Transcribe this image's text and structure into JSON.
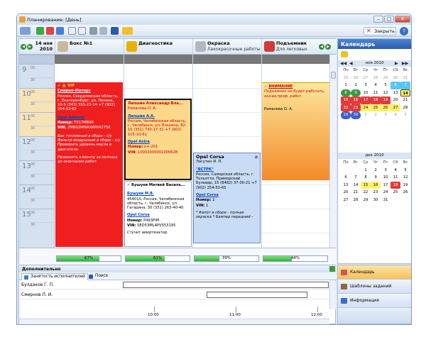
{
  "window": {
    "title": "Планирование: [День]",
    "close_label": "Закрыть",
    "help": "?"
  },
  "schedule": {
    "date_line1": "14 ноя",
    "date_line2": "2010",
    "columns": [
      {
        "name": "Бокс №1",
        "sub": ""
      },
      {
        "name": "Диагностика",
        "sub": ""
      },
      {
        "name": "Окраска",
        "sub": "Лакокрасочные работы"
      },
      {
        "name": "Подъемник",
        "sub": "Для легковых"
      }
    ],
    "hours": [
      "9",
      "10",
      "11",
      "12",
      "13",
      "14",
      "15"
    ],
    "minute_label": "00",
    "half_label": "30",
    "progress": [
      {
        "label": "67%",
        "value": 67
      },
      {
        "label": "61%",
        "value": 61
      },
      {
        "label": "39%",
        "value": 39
      },
      {
        "label": "44%",
        "value": 44
      }
    ]
  },
  "cards": {
    "vip": {
      "badge": "VIP",
      "company": "Смирно-Моторс",
      "addr": "Россия, Свердловская область, г. Екатеринбург, ул. Ленина, 10-5 (343) 355-22-14 +7 (902) 254-53-65",
      "car": "Opel Admiral",
      "num_label": "Номер:",
      "num": "Т917МВ98",
      "vin_label": "VIN:",
      "vin": "2МВGDM9AXKP042756",
      "note1": "Бак топливный в сборе - с/у Фильтр воздушный в сборе - с/у Проверить уровень масла в двигателе.",
      "note2": "Позвонить клиенту за полчаса до окончания работ."
    },
    "lapshin": {
      "title": "Лапшин Александр Вла...",
      "master": "Романова О. А.",
      "name": "Лапшин А.А.",
      "addr": "Россия, Челябинская область, г. Челябинск, ул. Ельхина, 82-10 (351) 740-17-31 +7 (902) 105-10-61",
      "car": "Opel Astra",
      "num_label": "Номер:",
      "num": "к+-201",
      "vin_label": "VIN:",
      "vin": "1000200000100962В"
    },
    "bushuev": {
      "title": "Бушуев Матвей Василь...",
      "name": "Бушуев М.В.",
      "addr": "454010, Россия, Челябинская область, г. Челябинск, ул. Гагарина, 30 (351) 263-40-40",
      "car": "Opel Corsa",
      "num_label": "Номер:",
      "num": "Р493РIМ",
      "vin_label": "VIN:",
      "vin": "SED5ЗМL4PV553195",
      "note": "Стучит амортизатор."
    },
    "corsa": {
      "title": "Opel Corsa",
      "master": "Лагутин И. П.",
      "company": "\"ВСТРК\"",
      "addr": "Россия, Самарская область, г. Тольятти, Приморский Бульвар, 15 (8482) 37-00-21 +7 (902) 254-53-65",
      "car": "Opel Corsa",
      "num_label": "Номер:",
      "num": "2",
      "vin_label": "VIN:",
      "vin": "1",
      "note": "* Капот в сборе - полная окраска * Бампер передний -"
    },
    "warning": {
      "title": "ВНИМАНИЕ",
      "text": "Подъемник не будет работать, хоз-ва проф. работ.",
      "master": "Романова О. А."
    }
  },
  "calendar": {
    "title": "Календарь",
    "dow": [
      "Пн",
      "Вт",
      "Ср",
      "Чт",
      "Пт",
      "Сб",
      "Вс"
    ],
    "nov": {
      "title": "ноя 2010",
      "days": [
        "25",
        "26",
        "27",
        "28",
        "29",
        "30",
        "31",
        "1",
        "2",
        "3",
        "4",
        "5",
        "6",
        "7",
        "8",
        "9",
        "10",
        "11",
        "12",
        "13",
        "14",
        "15",
        "16",
        "17",
        "18",
        "19",
        "20",
        "21",
        "22",
        "23",
        "24",
        "25",
        "26",
        "27",
        "28",
        "29",
        "30",
        "1",
        "2",
        "3",
        "4",
        "5"
      ]
    },
    "dec": {
      "title": "дек 2010",
      "days": [
        "",
        "",
        "1",
        "2",
        "3",
        "4",
        "5",
        "6",
        "7",
        "8",
        "9",
        "10",
        "11",
        "12",
        "13",
        "14",
        "15",
        "16",
        "17",
        "18",
        "19",
        "20",
        "21",
        "22",
        "23",
        "24",
        "25",
        "26",
        "27",
        "28",
        "29",
        "30",
        "31",
        "",
        ""
      ]
    },
    "accent_colors": {
      "green": "#3b9a3b",
      "red": "#e23a3a",
      "yellow": "#fff06a",
      "blue": "#3d5fd0",
      "cyan": "#5bc4ef"
    }
  },
  "bottom": {
    "title": "Дополнительно",
    "tabs": [
      "Занятость исполнителей",
      "Поиск"
    ],
    "rows": [
      "Булдаков Г. П.",
      "Смирнов П. И."
    ],
    "ticks": [
      "10:00",
      "11:00",
      "12:00"
    ]
  },
  "rnav": [
    "Календарь",
    "Шаблоны заданий",
    "Информация"
  ]
}
